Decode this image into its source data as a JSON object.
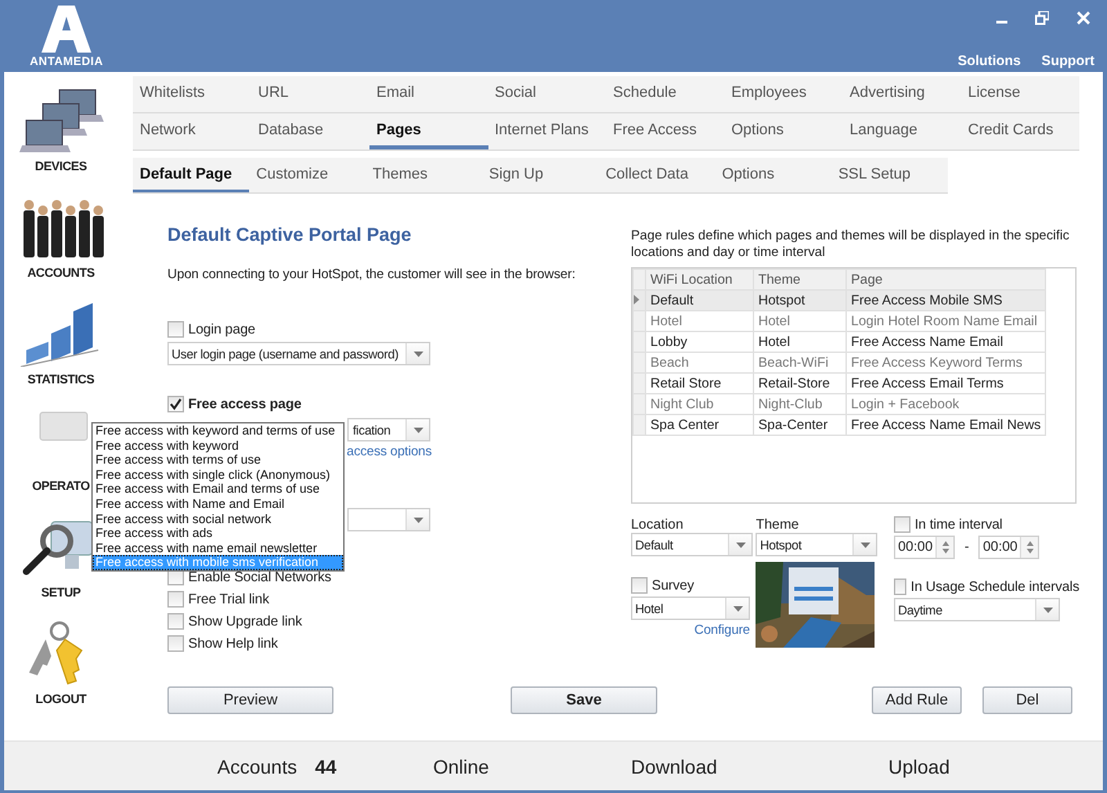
{
  "header": {
    "logo": "ANTAMEDIA",
    "links": [
      "Solutions",
      "Support"
    ]
  },
  "sidebar": {
    "items": [
      {
        "label": "DEVICES",
        "kind": "devices"
      },
      {
        "label": "ACCOUNTS",
        "kind": "accounts"
      },
      {
        "label": "STATISTICS",
        "kind": "statistics"
      },
      {
        "label": "OPERATO",
        "kind": "operators"
      },
      {
        "label": "SETUP",
        "kind": "setup"
      },
      {
        "label": "LOGOUT",
        "kind": "logout"
      }
    ]
  },
  "tab_rows": [
    {
      "tabs": [
        {
          "label": "Whitelists",
          "selected": false
        },
        {
          "label": "URL",
          "selected": false
        },
        {
          "label": "Email",
          "selected": false
        },
        {
          "label": "Social",
          "selected": false
        },
        {
          "label": "Schedule",
          "selected": false
        },
        {
          "label": "Employees",
          "selected": false
        },
        {
          "label": "Advertising",
          "selected": false
        },
        {
          "label": "License",
          "selected": false
        }
      ]
    },
    {
      "tabs": [
        {
          "label": "Network",
          "selected": false
        },
        {
          "label": "Database",
          "selected": false
        },
        {
          "label": "Pages",
          "selected": true
        },
        {
          "label": "Internet Plans",
          "selected": false
        },
        {
          "label": "Free Access",
          "selected": false
        },
        {
          "label": "Options",
          "selected": false
        },
        {
          "label": "Language",
          "selected": false
        },
        {
          "label": "Credit Cards",
          "selected": false
        }
      ]
    }
  ],
  "subtabs": [
    {
      "label": "Default Page",
      "selected": true
    },
    {
      "label": "Customize",
      "selected": false
    },
    {
      "label": "Themes",
      "selected": false
    },
    {
      "label": "Sign Up",
      "selected": false
    },
    {
      "label": "Collect Data",
      "selected": false
    },
    {
      "label": "Options",
      "selected": false
    },
    {
      "label": "SSL Setup",
      "selected": false
    }
  ],
  "default_page": {
    "title": "Default Captive Portal Page",
    "description": "Upon connecting to your HotSpot, the customer will see in the browser:",
    "login_page": {
      "label": "Login page",
      "checked": false,
      "value": "User login page (username and password)"
    },
    "free_access_page": {
      "label": "Free access page",
      "checked": true,
      "value": "fication",
      "link": "access options"
    },
    "options": [
      {
        "label": "Enable Social Networks",
        "checked": false
      },
      {
        "label": "Free Trial link",
        "checked": false
      },
      {
        "label": "Show Upgrade link",
        "checked": false
      },
      {
        "label": "Show Help link",
        "checked": false
      }
    ]
  },
  "dropdown_list": {
    "items": [
      {
        "label": "Free access with keyword and terms of use",
        "selected": false
      },
      {
        "label": "Free access with keyword",
        "selected": false
      },
      {
        "label": "Free access with terms of use",
        "selected": false
      },
      {
        "label": "Free access with single click (Anonymous)",
        "selected": false
      },
      {
        "label": "Free access with Email and terms of use",
        "selected": false
      },
      {
        "label": "Free access with Name and Email",
        "selected": false
      },
      {
        "label": "Free access with social network",
        "selected": false
      },
      {
        "label": "Free access with ads",
        "selected": false
      },
      {
        "label": "Free access with name email newsletter",
        "selected": false
      },
      {
        "label": "Free access with mobile sms verification",
        "selected": true
      }
    ]
  },
  "page_rules": {
    "description": "Page rules define which pages and themes will be displayed in the specific locations and day or time interval",
    "columns": [
      "WiFi Location",
      "Theme",
      "Page"
    ],
    "rows": [
      {
        "cells": [
          "Default",
          "Hotspot",
          "Free Access Mobile SMS"
        ],
        "selected": true
      },
      {
        "cells": [
          "Hotel",
          "Hotel",
          "Login Hotel Room Name Email"
        ],
        "selected": false
      },
      {
        "cells": [
          "Lobby",
          "Hotel",
          "Free Access Name Email"
        ],
        "selected": false
      },
      {
        "cells": [
          "Beach",
          "Beach-WiFi",
          "Free Access Keyword Terms"
        ],
        "selected": false
      },
      {
        "cells": [
          "Retail Store",
          "Retail-Store",
          "Free Access Email Terms"
        ],
        "selected": false
      },
      {
        "cells": [
          "Night Club",
          "Night-Club",
          "Login + Facebook"
        ],
        "selected": false
      },
      {
        "cells": [
          "Spa Center",
          "Spa-Center",
          "Free Access Name Email News"
        ],
        "selected": false
      }
    ]
  },
  "rule_editor": {
    "location": {
      "label": "Location",
      "value": "Default"
    },
    "theme": {
      "label": "Theme",
      "value": "Hotspot"
    },
    "time_interval": {
      "label": "In time interval",
      "checked": false,
      "from": "00:00",
      "separator": "-",
      "to": "00:00"
    },
    "survey": {
      "label": "Survey",
      "checked": false,
      "value": "Hotel",
      "link": "Configure"
    },
    "usage_schedule": {
      "label": "In Usage Schedule intervals",
      "checked": false,
      "value": "Daytime"
    }
  },
  "buttons": {
    "preview": "Preview",
    "save": "Save",
    "add_rule": "Add Rule",
    "delete": "Del"
  },
  "status_bar": [
    {
      "label": "Accounts",
      "value": "44"
    },
    {
      "label": "Online"
    },
    {
      "label": "Download"
    },
    {
      "label": "Upload"
    }
  ]
}
